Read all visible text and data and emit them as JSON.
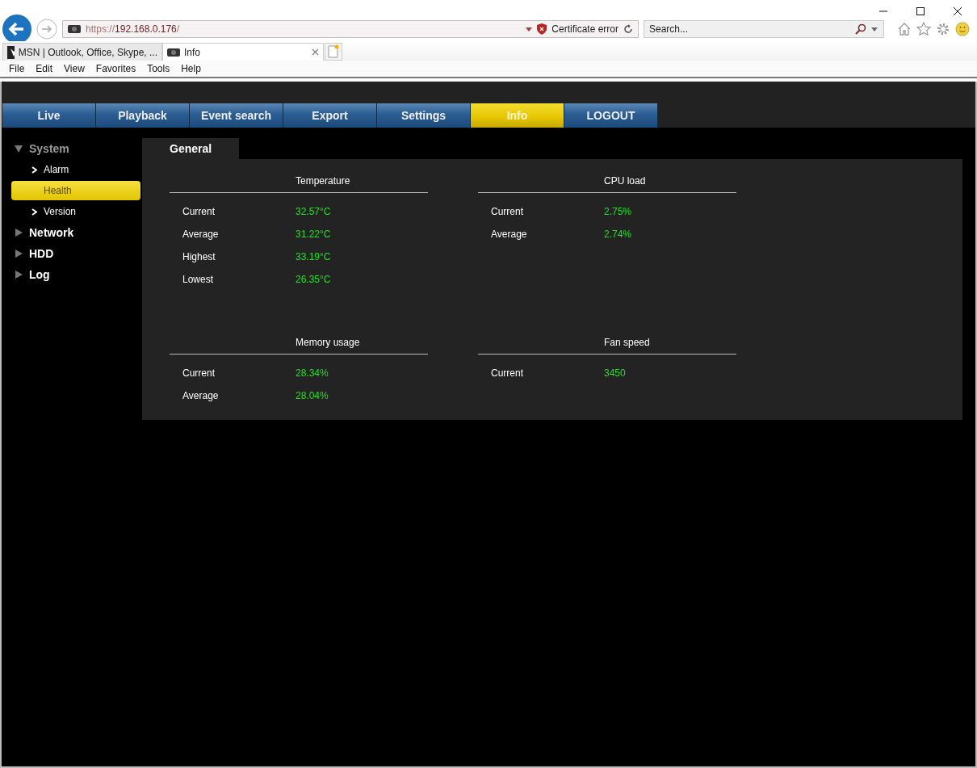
{
  "browser": {
    "address": {
      "scheme": "https://",
      "host": "192.168.0.176",
      "path": "/"
    },
    "certificate": "Certificate error",
    "search": {
      "placeholder": "Search..."
    },
    "tabs": [
      {
        "label": "MSN | Outlook, Office, Skype, ...",
        "selected": false
      },
      {
        "label": "Info",
        "selected": true
      }
    ],
    "menu": [
      "File",
      "Edit",
      "View",
      "Favorites",
      "Tools",
      "Help"
    ]
  },
  "nav": [
    {
      "label": "Live",
      "selected": false
    },
    {
      "label": "Playback",
      "selected": false
    },
    {
      "label": "Event search",
      "selected": false
    },
    {
      "label": "Export",
      "selected": false
    },
    {
      "label": "Settings",
      "selected": false
    },
    {
      "label": "Info",
      "selected": true
    },
    {
      "label": "LOGOUT",
      "selected": false
    }
  ],
  "sidebar": [
    {
      "label": "System",
      "expanded": true,
      "children": [
        {
          "label": "Alarm",
          "selected": false
        },
        {
          "label": "Health",
          "selected": true
        },
        {
          "label": "Version",
          "selected": false
        }
      ]
    },
    {
      "label": "Network",
      "expanded": false
    },
    {
      "label": "HDD",
      "expanded": false
    },
    {
      "label": "Log",
      "expanded": false
    }
  ],
  "panel": {
    "tab": "General",
    "sections": [
      {
        "title": "Temperature",
        "rows": [
          {
            "label": "Current",
            "value": "32.57°C"
          },
          {
            "label": "Average",
            "value": "31.22°C"
          },
          {
            "label": "Highest",
            "value": "33.19°C"
          },
          {
            "label": "Lowest",
            "value": "26.35°C"
          }
        ]
      },
      {
        "title": "CPU load",
        "rows": [
          {
            "label": "Current",
            "value": "2.75%"
          },
          {
            "label": "Average",
            "value": "2.74%"
          }
        ]
      },
      {
        "title": "Memory usage",
        "rows": [
          {
            "label": "Current",
            "value": "28.34%"
          },
          {
            "label": "Average",
            "value": "28.04%"
          }
        ]
      },
      {
        "title": "Fan speed",
        "rows": [
          {
            "label": "Current",
            "value": "3450"
          }
        ]
      }
    ]
  }
}
